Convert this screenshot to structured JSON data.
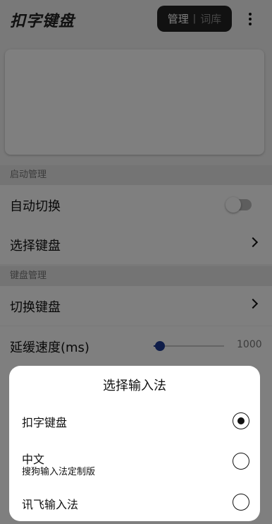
{
  "header": {
    "app_title": "扣字键盘",
    "segment_active": "管理",
    "segment_divider": "|",
    "segment_inactive": "词库",
    "more_icon": "more-vertical-icon"
  },
  "sections": {
    "launch_header": "启动管理",
    "auto_switch_label": "自动切换",
    "auto_switch_on": false,
    "select_keyboard_label": "选择键盘",
    "keyboard_header": "键盘管理",
    "switch_keyboard_label": "切换键盘",
    "delay_label": "延缓速度(ms)",
    "delay_value": "1000",
    "delay_fraction": 0.05
  },
  "dialog": {
    "title": "选择输入法",
    "options": [
      {
        "name": "扣字键盘",
        "sub": "",
        "selected": true
      },
      {
        "name": "中文",
        "sub": "搜狗输入法定制版",
        "selected": false
      },
      {
        "name": "讯飞输入法",
        "sub": "",
        "selected": false
      }
    ]
  },
  "colors": {
    "accent": "#1f3a93",
    "scrim": "rgba(0,0,0,0.5)"
  }
}
